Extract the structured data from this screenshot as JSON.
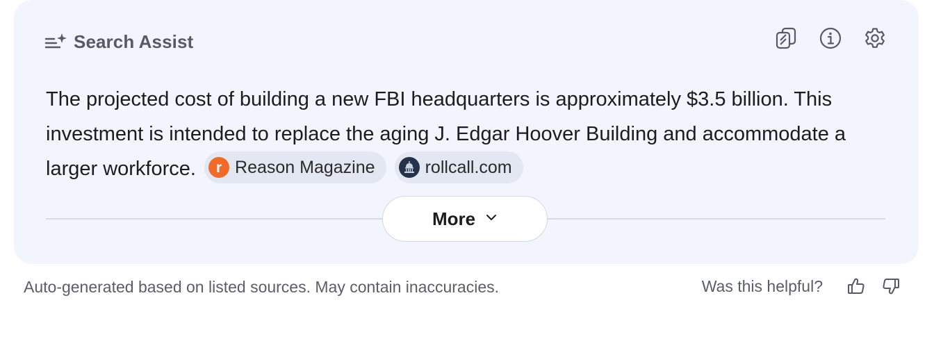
{
  "panel": {
    "title": "Search Assist",
    "actions": [
      {
        "name": "copy",
        "icon": "copy-icon"
      },
      {
        "name": "info",
        "icon": "info-icon"
      },
      {
        "name": "settings",
        "icon": "gear-icon"
      }
    ]
  },
  "answer": {
    "text": "The projected cost of building a new FBI headquarters is approximately $3.5 billion. This investment is intended to replace the aging J. Edgar Hoover Building and accommodate a larger workforce.",
    "sources": [
      {
        "label": "Reason Magazine",
        "favicon_letter": "r",
        "favicon_color": "#f06a2a"
      },
      {
        "label": "rollcall.com",
        "favicon_icon": "capitol-dome-icon",
        "favicon_color": "#26324a"
      }
    ]
  },
  "more_button": {
    "label": "More",
    "icon": "chevron-down-icon"
  },
  "footer": {
    "disclaimer": "Auto-generated based on listed sources. May contain inaccuracies.",
    "helpful_question": "Was this helpful?",
    "thumbs_up_icon": "thumbs-up-icon",
    "thumbs_down_icon": "thumbs-down-icon"
  },
  "colors": {
    "card_background": "#f2f5fd",
    "chip_background": "#e3e7f1",
    "reason_favicon": "#f06a2a",
    "rollcall_favicon": "#26324a"
  }
}
